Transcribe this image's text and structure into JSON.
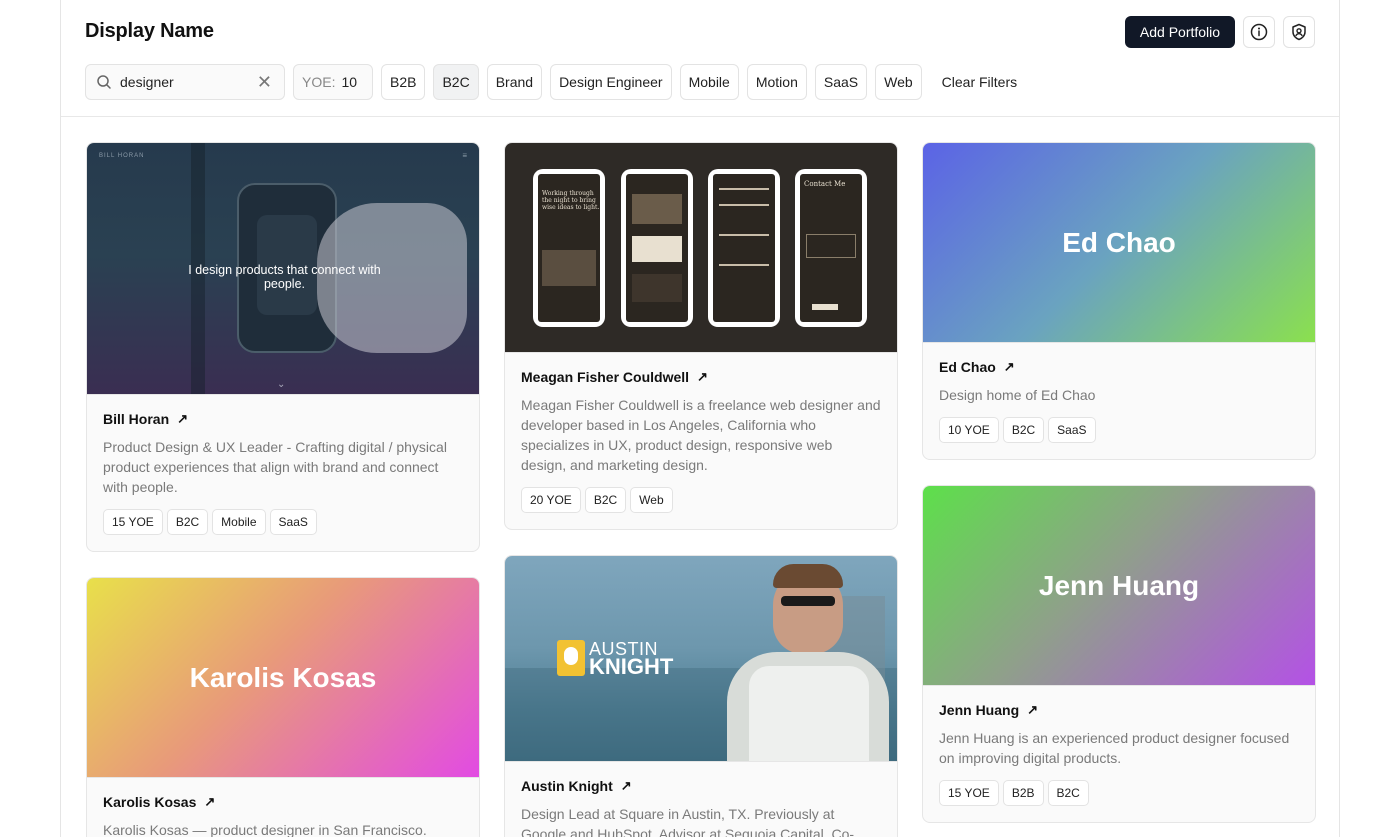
{
  "header": {
    "title": "Display Name",
    "add_button": "Add Portfolio",
    "info_icon": "info-icon",
    "shield_icon": "shield-user-icon"
  },
  "filters": {
    "search_value": "designer",
    "yoe_label": "YOE:",
    "yoe_value": "10",
    "chips": [
      "B2B",
      "B2C",
      "Brand",
      "Design Engineer",
      "Mobile",
      "Motion",
      "SaaS",
      "Web"
    ],
    "active_chip": "B2C",
    "clear_label": "Clear Filters"
  },
  "cards": [
    {
      "name": "Bill Horan",
      "desc": "Product Design & UX Leader - Crafting digital / physical product experiences that align with brand and connect with people.",
      "tags": [
        "15 YOE",
        "B2C",
        "Mobile",
        "SaaS"
      ],
      "image_caption": "I design products that connect with people.",
      "image_brand": "BILL HORAN"
    },
    {
      "name": "Meagan Fisher Couldwell",
      "desc": "Meagan Fisher Couldwell is a freelance web designer and developer based in Los Angeles, California who specializes in UX, product design, responsive web design, and marketing design.",
      "tags": [
        "20 YOE",
        "B2C",
        "Web"
      ],
      "image_heading": "Working through the night to bring wise ideas to light.",
      "image_contact": "Contact Me"
    },
    {
      "name": "Ed Chao",
      "desc": "Design home of Ed Chao",
      "tags": [
        "10 YOE",
        "B2C",
        "SaaS"
      ],
      "image_title": "Ed Chao"
    },
    {
      "name": "Karolis Kosas",
      "desc": "Karolis Kosas — product designer in San Francisco.",
      "tags": [],
      "image_title": "Karolis Kosas"
    },
    {
      "name": "Austin Knight",
      "desc": "Design Lead at Square in Austin, TX. Previously at Google and HubSpot. Advisor at Sequoia Capital. Co-",
      "tags": [],
      "image_logo_top": "AUSTIN",
      "image_logo_bottom": "KNIGHT"
    },
    {
      "name": "Jenn Huang",
      "desc": "Jenn Huang is an experienced product designer focused on improving digital products.",
      "tags": [
        "15 YOE",
        "B2B",
        "B2C"
      ],
      "image_title": "Jenn Huang"
    }
  ],
  "colors": {
    "primary_button": "#111827",
    "ed_chao_gradient": [
      "#5b63e6",
      "#8be04e"
    ],
    "karolis_gradient": [
      "#e8e04a",
      "#e24be3"
    ],
    "jenn_gradient": [
      "#5de04a",
      "#b451e6"
    ]
  }
}
